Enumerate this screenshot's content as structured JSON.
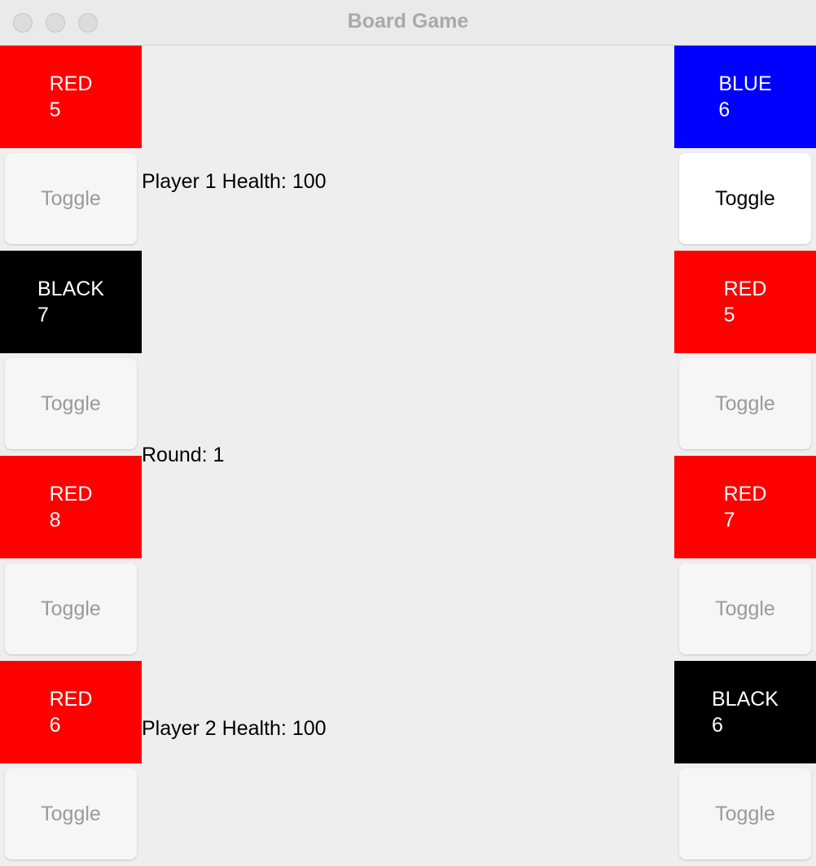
{
  "window": {
    "title": "Board Game"
  },
  "left_column": [
    {
      "color": "RED",
      "value": "5",
      "bg": "#ff0000",
      "toggle": "Toggle",
      "toggle_active": false
    },
    {
      "color": "BLACK",
      "value": "7",
      "bg": "#000000",
      "toggle": "Toggle",
      "toggle_active": false
    },
    {
      "color": "RED",
      "value": "8",
      "bg": "#ff0000",
      "toggle": "Toggle",
      "toggle_active": false
    },
    {
      "color": "RED",
      "value": "6",
      "bg": "#ff0000",
      "toggle": "Toggle",
      "toggle_active": false
    }
  ],
  "right_column": [
    {
      "color": "BLUE",
      "value": "6",
      "bg": "#0000ff",
      "toggle": "Toggle",
      "toggle_active": true
    },
    {
      "color": "RED",
      "value": "5",
      "bg": "#ff0000",
      "toggle": "Toggle",
      "toggle_active": false
    },
    {
      "color": "RED",
      "value": "7",
      "bg": "#ff0000",
      "toggle": "Toggle",
      "toggle_active": false
    },
    {
      "color": "BLACK",
      "value": "6",
      "bg": "#000000",
      "toggle": "Toggle",
      "toggle_active": false
    }
  ],
  "status": {
    "player1_health": "Player 1 Health: 100",
    "round": "Round: 1",
    "player2_health": "Player 2 Health: 100"
  }
}
